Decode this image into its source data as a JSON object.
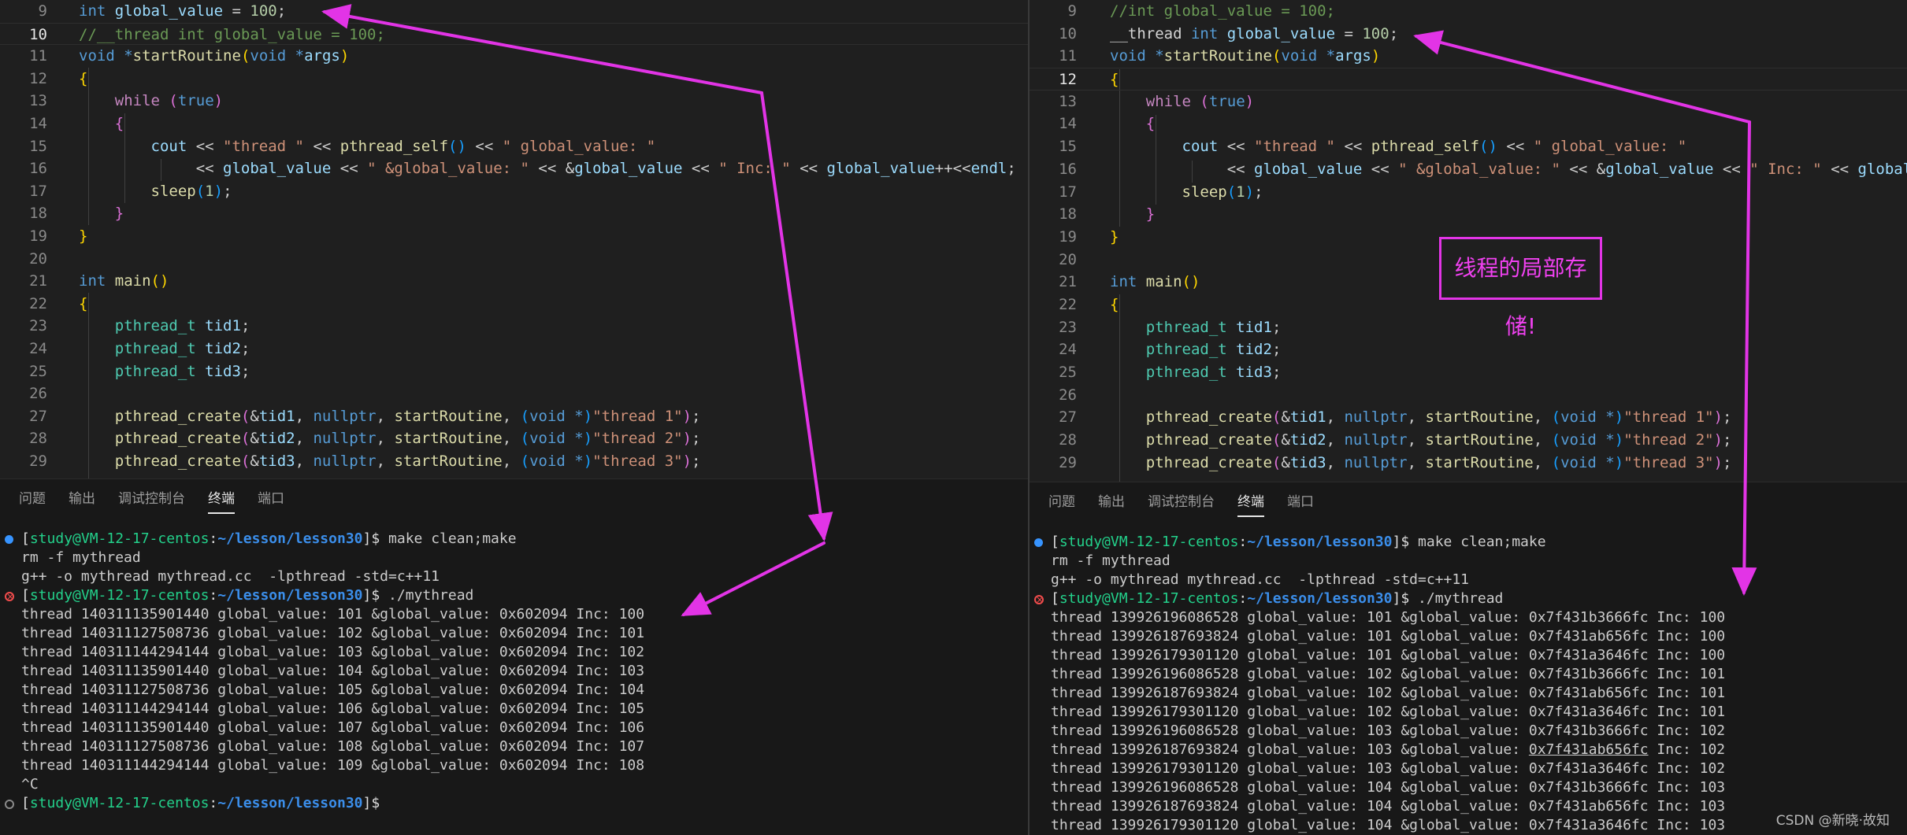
{
  "panel_tabs": [
    "问题",
    "输出",
    "调试控制台",
    "终端",
    "端口"
  ],
  "active_tab": "终端",
  "prompt": {
    "user_host": "study@VM-12-17-centos",
    "path": "~/lesson/lesson30"
  },
  "left": {
    "line_numbers": [
      "9",
      "10",
      "11",
      "12",
      "13",
      "14",
      "15",
      "16",
      "17",
      "18",
      "19",
      "20",
      "21",
      "22",
      "23",
      "24",
      "25",
      "26",
      "27",
      "28",
      "29"
    ],
    "terminal": {
      "cmd1": "make clean;make",
      "out1": [
        "rm -f mythread",
        "g++ -o mythread mythread.cc  -lpthread -std=c++11"
      ],
      "cmd2": "./mythread",
      "rows": [
        "thread 140311135901440 global_value: 101 &global_value: 0x602094 Inc: 100",
        "thread 140311127508736 global_value: 102 &global_value: 0x602094 Inc: 101",
        "thread 140311144294144 global_value: 103 &global_value: 0x602094 Inc: 102",
        "thread 140311135901440 global_value: 104 &global_value: 0x602094 Inc: 103",
        "thread 140311127508736 global_value: 105 &global_value: 0x602094 Inc: 104",
        "thread 140311144294144 global_value: 106 &global_value: 0x602094 Inc: 105",
        "thread 140311135901440 global_value: 107 &global_value: 0x602094 Inc: 106",
        "thread 140311127508736 global_value: 108 &global_value: 0x602094 Inc: 107",
        "thread 140311144294144 global_value: 109 &global_value: 0x602094 Inc: 108"
      ],
      "interrupt": "^C"
    }
  },
  "right": {
    "line_numbers": [
      "9",
      "10",
      "11",
      "12",
      "13",
      "14",
      "15",
      "16",
      "17",
      "18",
      "19",
      "20",
      "21",
      "22",
      "23",
      "24",
      "25",
      "26",
      "27",
      "28",
      "29"
    ],
    "terminal": {
      "cmd1": "make clean;make",
      "out1": [
        "rm -f mythread",
        "g++ -o mythread mythread.cc  -lpthread -std=c++11"
      ],
      "cmd2": "./mythread",
      "rows": [
        "thread 139926196086528 global_value: 101 &global_value: 0x7f431b3666fc Inc: 100",
        "thread 139926187693824 global_value: 101 &global_value: 0x7f431ab656fc Inc: 100",
        "thread 139926179301120 global_value: 101 &global_value: 0x7f431a3646fc Inc: 100",
        "thread 139926196086528 global_value: 102 &global_value: 0x7f431b3666fc Inc: 101",
        "thread 139926187693824 global_value: 102 &global_value: 0x7f431ab656fc Inc: 101",
        "thread 139926179301120 global_value: 102 &global_value: 0x7f431a3646fc Inc: 101",
        "thread 139926196086528 global_value: 103 &global_value: 0x7f431b3666fc Inc: 102",
        "thread 139926187693824 global_value: 103 &global_value: ",
        "thread 139926179301120 global_value: 103 &global_value: 0x7f431a3646fc Inc: 102",
        "thread 139926196086528 global_value: 104 &global_value: 0x7f431b3666fc Inc: 103",
        "thread 139926187693824 global_value: 104 &global_value: 0x7f431ab656fc Inc: 103",
        "thread 139926179301120 global_value: 104 &global_value: 0x7f431a3646fc Inc: 103"
      ],
      "underlined_addr": "0x7f431ab656fc",
      "underlined_suffix": " Inc: 102"
    }
  },
  "callout": "线程的局部存储!",
  "watermark": "CSDN @新晓·故知",
  "colors": {
    "arrow": "#e234e6",
    "keyword": "#569cd6",
    "type": "#4ec9b0",
    "function": "#dcdcaa",
    "variable": "#9cdcfe",
    "string": "#ce9178",
    "comment": "#6a9955"
  }
}
